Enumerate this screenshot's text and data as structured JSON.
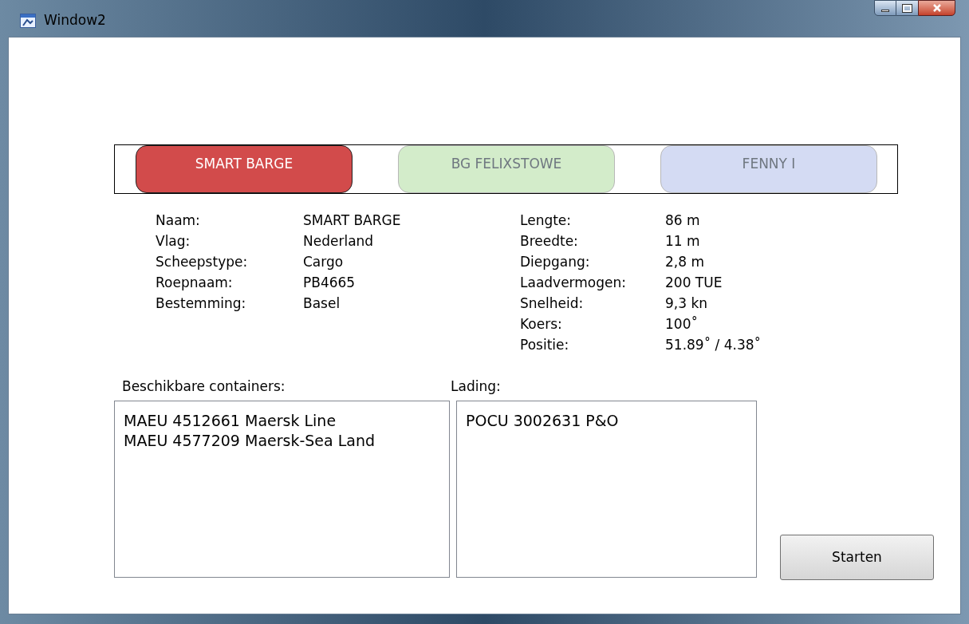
{
  "window": {
    "title": "Window2"
  },
  "ships": [
    {
      "label": "SMART BARGE",
      "selected": true,
      "color": "#d24b4b"
    },
    {
      "label": "BG FELIXSTOWE",
      "selected": false,
      "color": "#d3ecca"
    },
    {
      "label": "FENNY I",
      "selected": false,
      "color": "#d4dbf3"
    }
  ],
  "details_left": [
    {
      "label": "Naam:",
      "value": "SMART BARGE"
    },
    {
      "label": "Vlag:",
      "value": "Nederland"
    },
    {
      "label": "Scheepstype:",
      "value": "Cargo"
    },
    {
      "label": "Roepnaam:",
      "value": "PB4665"
    },
    {
      "label": "Bestemming:",
      "value": "Basel"
    }
  ],
  "details_right": [
    {
      "label": "Lengte:",
      "value": "86 m"
    },
    {
      "label": "Breedte:",
      "value": "11 m"
    },
    {
      "label": "Diepgang:",
      "value": "2,8 m"
    },
    {
      "label": "Laadvermogen:",
      "value": "200 TUE"
    },
    {
      "label": "Snelheid:",
      "value": "9,3 kn"
    },
    {
      "label": "Koers:",
      "value": "100˚"
    },
    {
      "label": "Positie:",
      "value": "51.89˚ / 4.38˚"
    }
  ],
  "available": {
    "label": "Beschikbare containers:",
    "items": [
      "MAEU 4512661 Maersk Line",
      "MAEU 4577209 Maersk-Sea Land"
    ]
  },
  "cargo": {
    "label": "Lading:",
    "items": [
      "POCU 3002631 P&O"
    ]
  },
  "start_button": "Starten"
}
